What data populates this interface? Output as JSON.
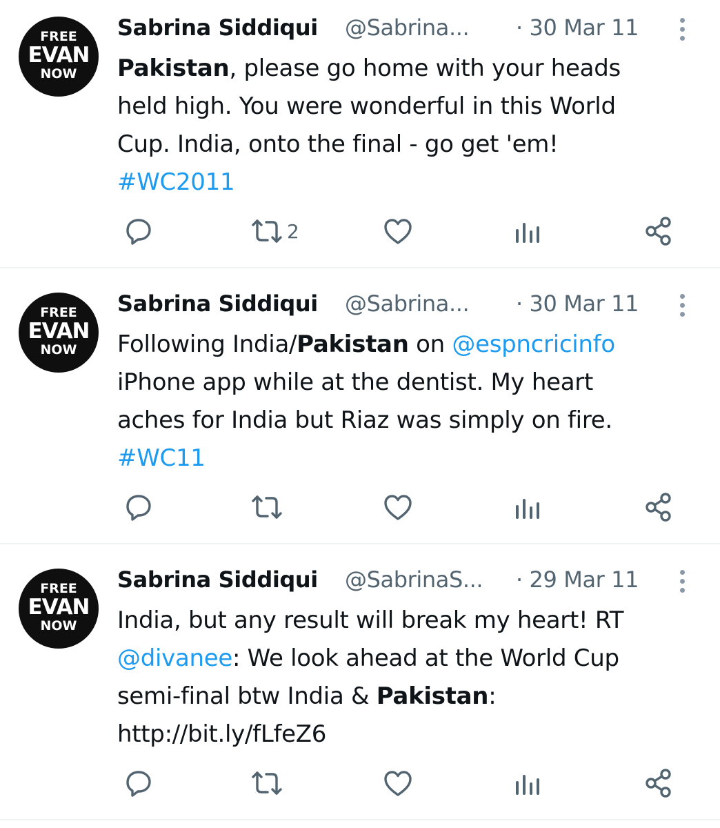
{
  "colors": {
    "link": "#1d9bf0",
    "secondary_text": "#536471",
    "divider": "#eff3f4",
    "avatar_bg": "#0f0f0f"
  },
  "tweets": [
    {
      "author": {
        "name": "Sabrina Siddiqui",
        "handle": "@Sabrina...",
        "avatar_lines": [
          "FREE",
          "EVAN",
          "NOW"
        ]
      },
      "date": "· 30 Mar 11",
      "lines": [
        [
          {
            "text": "Pakistan",
            "style": "bold"
          },
          {
            "text": ", please go home with your heads",
            "style": "plain"
          }
        ],
        [
          {
            "text": "held high. You were wonderful in this World",
            "style": "plain"
          }
        ],
        [
          {
            "text": "Cup. India, onto the final - go get 'em!",
            "style": "plain"
          }
        ],
        [
          {
            "text": "#WC2011",
            "style": "link"
          }
        ]
      ],
      "actions": {
        "reply": "",
        "retweet": "2",
        "like": "",
        "views": ""
      }
    },
    {
      "author": {
        "name": "Sabrina Siddiqui",
        "handle": "@Sabrina...",
        "avatar_lines": [
          "FREE",
          "EVAN",
          "NOW"
        ]
      },
      "date": "· 30 Mar 11",
      "lines": [
        [
          {
            "text": "Following India/",
            "style": "plain"
          },
          {
            "text": "Pakistan",
            "style": "bold"
          },
          {
            "text": " on ",
            "style": "plain"
          },
          {
            "text": "@espncricinfo",
            "style": "link"
          }
        ],
        [
          {
            "text": "iPhone app while at the dentist. My heart",
            "style": "plain"
          }
        ],
        [
          {
            "text": "aches for India but Riaz was simply on fire.",
            "style": "plain"
          }
        ],
        [
          {
            "text": "#WC11",
            "style": "link"
          }
        ]
      ],
      "actions": {
        "reply": "",
        "retweet": "",
        "like": "",
        "views": ""
      }
    },
    {
      "author": {
        "name": "Sabrina Siddiqui",
        "handle": "@SabrinaS...",
        "avatar_lines": [
          "FREE",
          "EVAN",
          "NOW"
        ]
      },
      "date": "· 29 Mar 11",
      "lines": [
        [
          {
            "text": "India, but any result will break my heart! RT",
            "style": "plain"
          }
        ],
        [
          {
            "text": "@divanee",
            "style": "link"
          },
          {
            "text": ": We look ahead at the World Cup",
            "style": "plain"
          }
        ],
        [
          {
            "text": "semi-final btw India & ",
            "style": "plain"
          },
          {
            "text": "Pakistan",
            "style": "bold"
          },
          {
            "text": ":",
            "style": "plain"
          }
        ],
        [
          {
            "text": "http://bit.ly/fLfeZ6",
            "style": "plain"
          }
        ]
      ],
      "actions": {
        "reply": "",
        "retweet": "",
        "like": "",
        "views": ""
      }
    }
  ]
}
